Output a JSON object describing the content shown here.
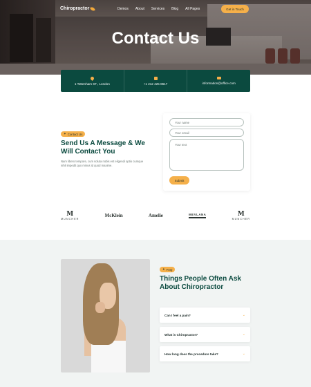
{
  "nav": {
    "logo": "Chiropractor",
    "menu": [
      "Demos",
      "About",
      "Services",
      "Blog",
      "All Pages"
    ],
    "cta": "Get in Touch"
  },
  "hero": {
    "title": "Contact Us"
  },
  "info": [
    {
      "icon": "location-pin-icon",
      "text": "1 Tottenham ST., London"
    },
    {
      "icon": "phone-icon",
      "text": "+1 212 425 8617"
    },
    {
      "icon": "mail-icon",
      "text": "information@office.com"
    }
  ],
  "contact": {
    "tag": "Contact Us",
    "title": "Send Us A Message & We Will Contact You",
    "description": "Nam libero tempore, cum soluta nobis est eligendi optio cumque nihil impedit quo minus id quod maxime.",
    "form": {
      "name_placeholder": "Your name",
      "email_placeholder": "Your email",
      "text_placeholder": "Your text",
      "submit": "Submit"
    }
  },
  "brands": [
    {
      "mark": "M",
      "name": "MUNCHER"
    },
    {
      "mark": "",
      "name": "McKlein"
    },
    {
      "mark": "",
      "name": "Amelie"
    },
    {
      "mark": "",
      "name": "MEVLANA"
    },
    {
      "mark": "M",
      "name": "MUNCHER"
    }
  ],
  "faq": {
    "tag": "FAQ",
    "title": "Things People Often Ask About Chiropractor",
    "items": [
      "Can I feel a pain?",
      "What is Chiropractor?",
      "How long does the procedure take?"
    ]
  },
  "colors": {
    "primary": "#0b4a3f",
    "accent": "#f5b04a"
  }
}
